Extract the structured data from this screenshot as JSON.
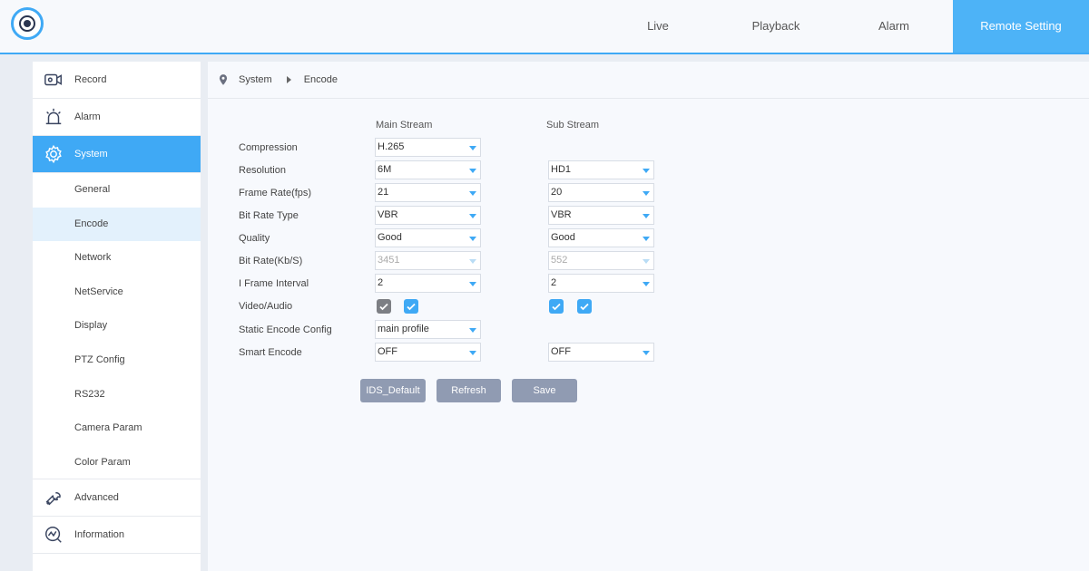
{
  "nav": {
    "items": [
      {
        "label": "Live",
        "active": false
      },
      {
        "label": "Playback",
        "active": false
      },
      {
        "label": "Alarm",
        "active": false
      },
      {
        "label": "Remote Setting",
        "active": true
      }
    ]
  },
  "sidebar": {
    "record": "Record",
    "alarm": "Alarm",
    "system": "System",
    "subitems": [
      "General",
      "Encode",
      "Network",
      "NetService",
      "Display",
      "PTZ Config",
      "RS232",
      "Camera Param",
      "Color Param"
    ],
    "active_subitem": "Encode",
    "advanced": "Advanced",
    "information": "Information"
  },
  "breadcrumb": {
    "level1": "System",
    "level2": "Encode"
  },
  "form": {
    "main_stream_header": "Main Stream",
    "sub_stream_header": "Sub Stream",
    "labels": {
      "compression": "Compression",
      "resolution": "Resolution",
      "frame_rate": "Frame Rate(fps)",
      "bit_rate_type": "Bit Rate Type",
      "quality": "Quality",
      "bit_rate": "Bit Rate(Kb/S)",
      "iframe": "I Frame Interval",
      "video_audio": "Video/Audio",
      "static_encode": "Static Encode Config",
      "smart_encode": "Smart Encode"
    },
    "main": {
      "compression": "H.265",
      "resolution": "6M",
      "frame_rate": "21",
      "bit_rate_type": "VBR",
      "quality": "Good",
      "bit_rate": "3451",
      "iframe": "2",
      "video_checked": true,
      "audio_checked": true,
      "static_encode": "main profile",
      "smart_encode": "OFF"
    },
    "sub": {
      "resolution": "HD1",
      "frame_rate": "20",
      "bit_rate_type": "VBR",
      "quality": "Good",
      "bit_rate": "552",
      "iframe": "2",
      "video_checked": true,
      "audio_checked": true,
      "smart_encode": "OFF"
    }
  },
  "buttons": {
    "default": "IDS_Default",
    "refresh": "Refresh",
    "save": "Save"
  },
  "colors": {
    "accent": "#3fa9f5",
    "button": "#909bb2",
    "checkbox_gray": "#7d7f84"
  }
}
